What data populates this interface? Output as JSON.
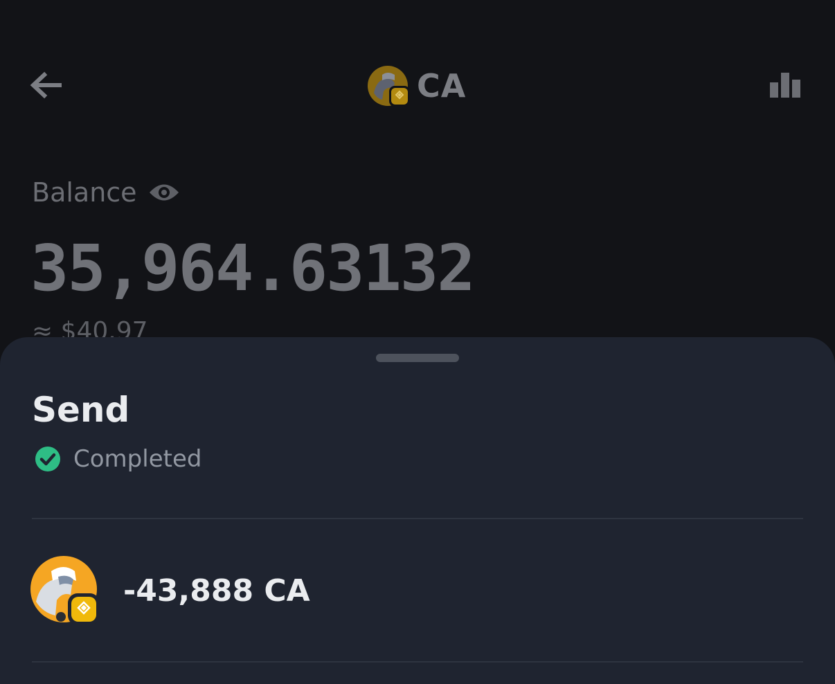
{
  "header": {
    "back_icon": "arrow-left-icon",
    "token_symbol": "CA",
    "chart_icon": "bar-chart-icon"
  },
  "balance": {
    "label": "Balance",
    "visibility_icon": "eye-icon",
    "amount": "35,964.63132",
    "usd_approx": "≈ $40.97"
  },
  "sheet": {
    "title": "Send",
    "status": "Completed",
    "status_icon": "check-circle-icon",
    "status_color": "#2ebd85",
    "amount": "-43,888 CA"
  },
  "colors": {
    "background": "#121317",
    "sheet_background": "#1f2430",
    "token_badge": "#f0b90b"
  }
}
